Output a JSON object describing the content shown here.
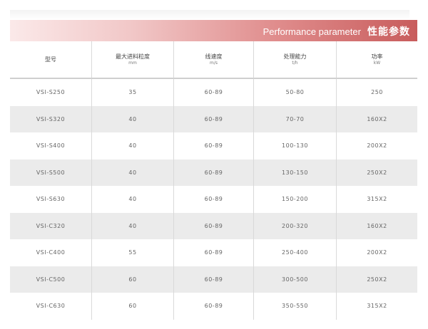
{
  "banner": {
    "title_en": "Performance parameter",
    "title_cn": "性能参数"
  },
  "table": {
    "headers": [
      {
        "label": "型号",
        "unit": ""
      },
      {
        "label": "最大进料粒度",
        "unit": "mm"
      },
      {
        "label": "线速度",
        "unit": "m/s"
      },
      {
        "label": "处理能力",
        "unit": "t/h"
      },
      {
        "label": "功率",
        "unit": "kW"
      }
    ],
    "rows": [
      [
        "VSI-S250",
        "35",
        "60-89",
        "50-80",
        "250"
      ],
      [
        "VSI-S320",
        "40",
        "60-89",
        "70-70",
        "160X2"
      ],
      [
        "VSI-S400",
        "40",
        "60-89",
        "100-130",
        "200X2"
      ],
      [
        "VSI-S500",
        "40",
        "60-89",
        "130-150",
        "250X2"
      ],
      [
        "VSI-S630",
        "40",
        "60-89",
        "150-200",
        "315X2"
      ],
      [
        "VSI-C320",
        "40",
        "60-89",
        "200-320",
        "160X2"
      ],
      [
        "VSI-C400",
        "55",
        "60-89",
        "250-400",
        "200X2"
      ],
      [
        "VSI-C500",
        "60",
        "60-89",
        "300-500",
        "250X2"
      ],
      [
        "VSI-C630",
        "60",
        "60-89",
        "350-550",
        "315X2"
      ]
    ]
  }
}
